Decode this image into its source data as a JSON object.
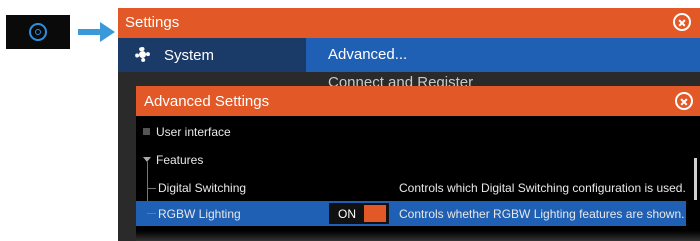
{
  "settings": {
    "title": "Settings",
    "sidebar": {
      "system_label": "System"
    },
    "menu": {
      "advanced_label": "Advanced...",
      "connect_label": "Connect and Register"
    }
  },
  "advanced_dialog": {
    "title": "Advanced Settings",
    "items": {
      "user_interface": "User interface",
      "features": "Features",
      "digital_switching": {
        "label": "Digital Switching",
        "description": "Controls which Digital Switching configuration is used."
      },
      "rgbw_lighting": {
        "label": "RGBW Lighting",
        "toggle": "ON",
        "description": "Controls whether RGBW Lighting features are shown."
      }
    }
  },
  "colors": {
    "titlebar": "#e35827",
    "selection": "#1f5fb4",
    "sidebar": "#1a3a68",
    "arrow": "#3a9ad9"
  },
  "icons": {
    "home_tile": "settings-gear-icon",
    "system": "gear-icon",
    "close": "close-icon"
  }
}
